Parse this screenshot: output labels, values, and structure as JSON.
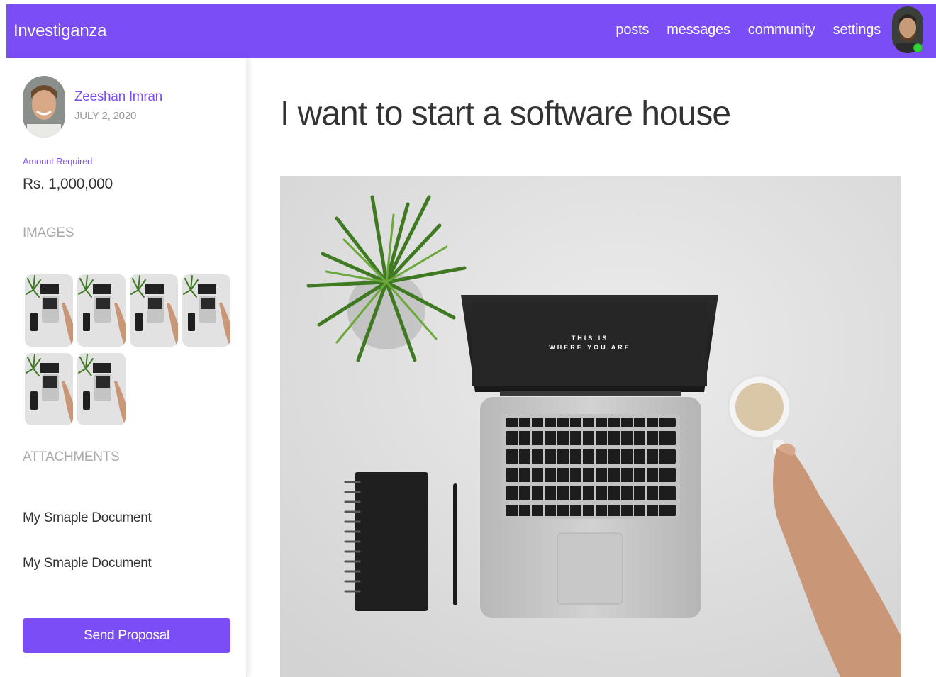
{
  "app": {
    "brand": "Investiganza"
  },
  "nav": {
    "items": [
      {
        "label": "posts"
      },
      {
        "label": "messages"
      },
      {
        "label": "community"
      },
      {
        "label": "settings"
      }
    ],
    "avatar_icon": "user-avatar-icon",
    "status_color": "#33d43a"
  },
  "post": {
    "author": "Zeeshan Imran",
    "date": "JULY 2, 2020",
    "amount_label": "Amount Required",
    "amount": "Rs. 1,000,000",
    "title": "I want to start a software house",
    "images_heading": "IMAGES",
    "image_count": 6,
    "attachments_heading": "ATTACHMENTS",
    "attachments": [
      {
        "name": "My Smaple Document"
      },
      {
        "name": "My Smaple Document"
      }
    ],
    "send_label": "Send Proposal",
    "hero_screen_text": [
      "THIS IS",
      "WHERE YOU ARE"
    ]
  },
  "colors": {
    "accent": "#7a4df5",
    "online": "#33d43a"
  }
}
